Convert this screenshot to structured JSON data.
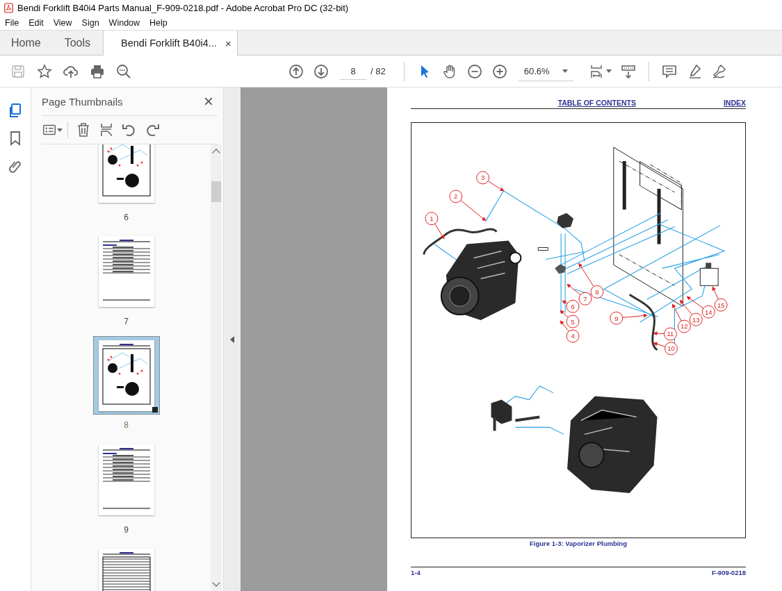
{
  "window": {
    "title": "Bendi Forklift B40i4 Parts Manual_F-909-0218.pdf - Adobe Acrobat Pro DC (32-bit)"
  },
  "menu": [
    "File",
    "Edit",
    "View",
    "Sign",
    "Window",
    "Help"
  ],
  "tabs": [
    {
      "label": "Home",
      "kind": "nav",
      "selected": false
    },
    {
      "label": "Tools",
      "kind": "nav",
      "selected": false
    },
    {
      "label": "Bendi Forklift B40i4...",
      "kind": "document",
      "selected": true,
      "close": "×"
    }
  ],
  "toolbar": {
    "left_tools": [
      {
        "kind": "save",
        "disabled": true
      },
      {
        "kind": "star",
        "disabled": false
      },
      {
        "kind": "upload",
        "disabled": false
      },
      {
        "kind": "print",
        "disabled": false
      },
      {
        "kind": "find",
        "disabled": false
      }
    ],
    "page_number": "8",
    "page_total": "/ 82",
    "mode_tools": [
      {
        "kind": "select",
        "selected": true
      },
      {
        "kind": "hand",
        "selected": false
      }
    ],
    "zoom": "60.6%"
  },
  "side_rail": [
    {
      "kind": "pages",
      "selected": true
    },
    {
      "kind": "bookmark",
      "selected": false
    },
    {
      "kind": "attachment",
      "selected": false
    }
  ],
  "panel": {
    "title": "Page Thumbnails",
    "close": "×",
    "thumbnails": [
      {
        "label": "6",
        "kind": "diagram",
        "selected": false
      },
      {
        "label": "7",
        "kind": "parts-list",
        "selected": false
      },
      {
        "label": "8",
        "kind": "diagram",
        "selected": true
      },
      {
        "label": "9",
        "kind": "parts-list",
        "selected": false
      },
      {
        "kind": "table",
        "selected": false
      }
    ]
  },
  "page": {
    "header_links": [
      "TABLE OF CONTENTS",
      "INDEX"
    ],
    "figure": {
      "callouts": [
        "1",
        "2",
        "3",
        "6",
        "5",
        "4",
        "7",
        "8",
        "9",
        "10",
        "11",
        "12",
        "13",
        "14",
        "15"
      ],
      "caption": "Figure 1-3:  Vaporizer Plumbing"
    },
    "footer_left": "1-4",
    "footer_right": "F-909-0218"
  }
}
